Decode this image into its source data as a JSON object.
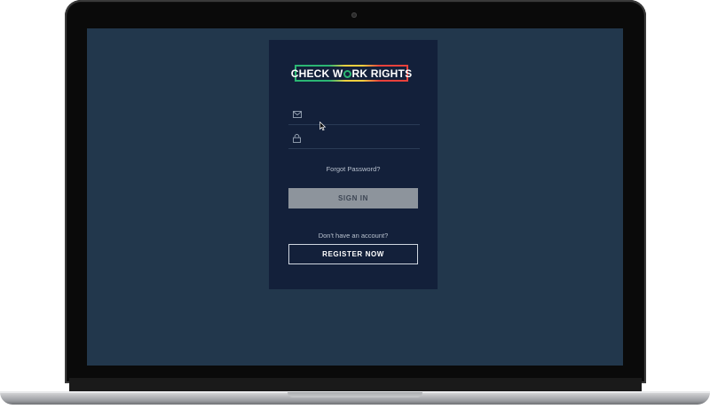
{
  "colors": {
    "screen_bg": "#22374c",
    "card_bg": "#13203a",
    "logo_green": "#2bb673",
    "logo_yellow": "#f4d03f",
    "logo_red": "#e8413c",
    "signin_bg": "#8d949c"
  },
  "logo": {
    "text_before": "CHECK W",
    "text_after": "RK RIGHTS"
  },
  "form": {
    "email": {
      "icon": "mail-icon",
      "value": "",
      "placeholder": ""
    },
    "password": {
      "icon": "lock-icon",
      "value": "",
      "placeholder": ""
    },
    "forgot_password": "Forgot Password?",
    "sign_in_label": "SIGN IN",
    "no_account_text": "Don't have an account?",
    "register_label": "REGISTER NOW"
  }
}
